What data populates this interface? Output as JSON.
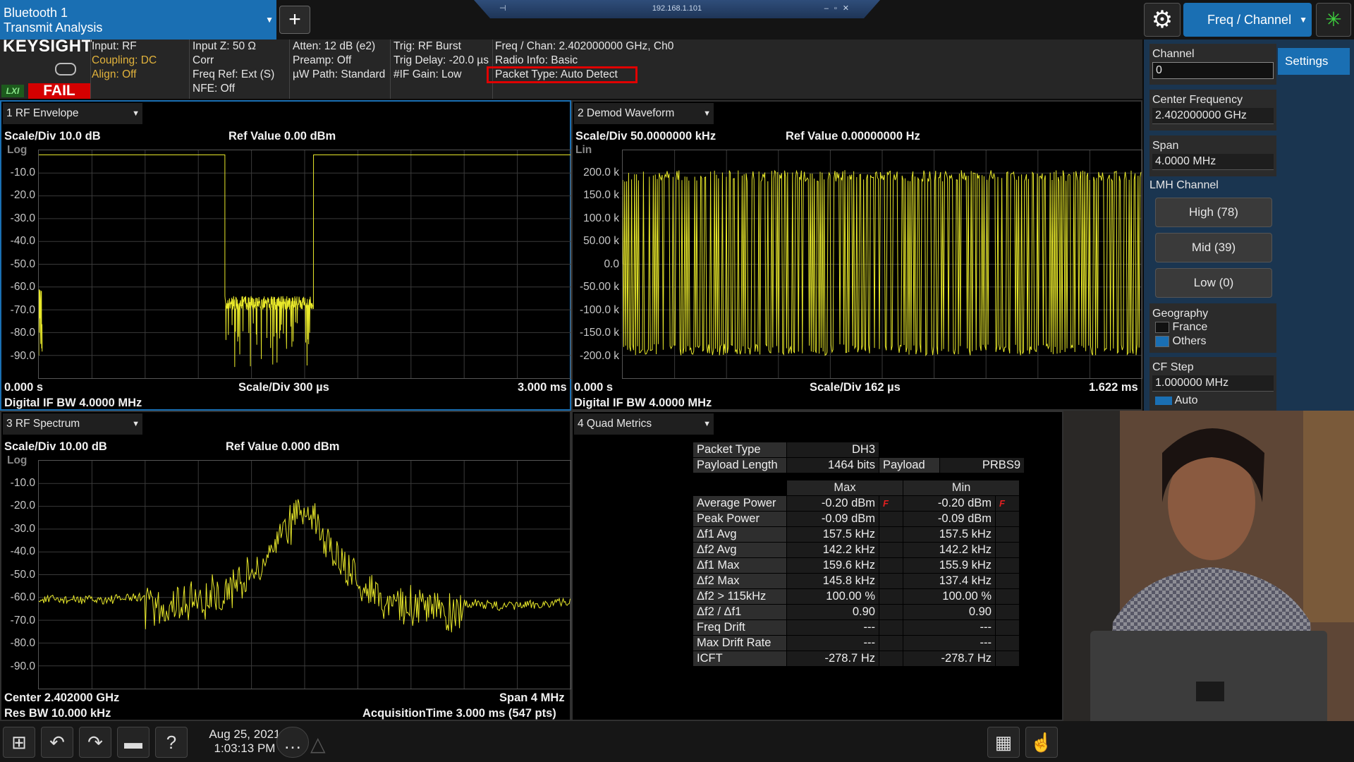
{
  "app": {
    "name_line1": "Bluetooth 1",
    "name_line2": "Transmit Analysis",
    "add_label": "+"
  },
  "remote": {
    "address": "192.168.1.101"
  },
  "menu": {
    "label": "Freq / Channel",
    "settings_tab": "Settings"
  },
  "status": {
    "brand": "KEYSIGHT",
    "lxi": "LXI",
    "fail": "FAIL",
    "col1": [
      "Input: RF",
      "Coupling: DC",
      "Align: Off"
    ],
    "col2": [
      "Input Z: 50 Ω",
      "Corr",
      "Freq Ref: Ext (S)",
      "NFE: Off"
    ],
    "col3": [
      "Atten: 12 dB (e2)",
      "Preamp: Off",
      "µW Path: Standard"
    ],
    "col4": [
      "Trig: RF Burst",
      "Trig Delay: -20.0 µs",
      "#IF Gain: Low"
    ],
    "col5": [
      "Freq / Chan: 2.402000000 GHz, Ch0",
      "Radio Info: Basic",
      "Packet Type: Auto Detect"
    ],
    "colors": {
      "warn": "#e2b33c",
      "fail": "#d40000",
      "trace": "#e8e82a",
      "accent": "#1a6fb3"
    }
  },
  "windows": [
    {
      "title": "1 RF Envelope",
      "scale": "Scale/Div 10.0 dB",
      "ref": "Ref Value 0.00 dBm",
      "mode": "Log",
      "yticks": [
        "-10.0",
        "-20.0",
        "-30.0",
        "-40.0",
        "-50.0",
        "-60.0",
        "-70.0",
        "-80.0",
        "-90.0"
      ],
      "start": "0.000 s",
      "center": "Scale/Div 300 µs",
      "stop": "3.000 ms",
      "foot": "Digital IF BW 4.0000 MHz"
    },
    {
      "title": "2 Demod Waveform",
      "scale": "Scale/Div 50.0000000 kHz",
      "ref": "Ref Value 0.00000000 Hz",
      "mode": "Lin",
      "yticks": [
        "200.0 k",
        "150.0 k",
        "100.0 k",
        "50.00 k",
        "0.0",
        "-50.00 k",
        "-100.0 k",
        "-150.0 k",
        "-200.0 k"
      ],
      "start": "0.000 s",
      "center": "Scale/Div 162 µs",
      "stop": "1.622 ms",
      "foot": "Digital IF BW 4.0000 MHz"
    },
    {
      "title": "3 RF Spectrum",
      "scale": "Scale/Div 10.00 dB",
      "ref": "Ref Value 0.000 dBm",
      "mode": "Log",
      "yticks": [
        "-10.0",
        "-20.0",
        "-30.0",
        "-40.0",
        "-50.0",
        "-60.0",
        "-70.0",
        "-80.0",
        "-90.0"
      ],
      "center_freq": "Center 2.402000 GHz",
      "span": "Span 4 MHz",
      "rbw": "Res BW 10.000 kHz",
      "acq": "AcquisitionTime 3.000 ms (547 pts)"
    },
    {
      "title": "4 Quad Metrics"
    }
  ],
  "chart_data": [
    {
      "type": "line",
      "title": "1 RF Envelope",
      "ylabel": "dBm",
      "ylim": [
        -100,
        0
      ],
      "xlim": [
        0,
        3.0
      ],
      "x_unit": "ms",
      "series": [
        {
          "values_summary": "burst at about -2 dBm from 0 to 1.05 ms, noise near -65 to -95 dBm from 1.05 to 1.55 ms, burst at about -2 dBm from 1.55 to 3.0 ms"
        }
      ],
      "x": [
        0.0,
        1.05,
        1.06,
        1.55,
        1.56,
        3.0
      ],
      "y": [
        -2,
        -2,
        -65,
        -65,
        -2,
        -2
      ]
    },
    {
      "type": "line",
      "title": "2 Demod Waveform",
      "ylabel": "Hz",
      "ylim": [
        -200000,
        200000
      ],
      "xlim": [
        0,
        1.622
      ],
      "x_unit": "ms",
      "x": [
        0,
        1.622
      ],
      "y_band": [
        -160000,
        165000
      ]
    },
    {
      "type": "line",
      "title": "3 RF Spectrum",
      "ylabel": "dBm",
      "ylim": [
        -100,
        0
      ],
      "xlim": [
        2400,
        2404
      ],
      "x_unit": "MHz",
      "x": [
        2400.0,
        2400.5,
        2401.0,
        2401.4,
        2401.7,
        2402.0,
        2402.3,
        2402.6,
        2403.0,
        2403.5,
        2404.0
      ],
      "y": [
        -60,
        -60,
        -58,
        -52,
        -40,
        -13,
        -40,
        -55,
        -60,
        -63,
        -61
      ]
    }
  ],
  "quad": {
    "packet_type_label": "Packet Type",
    "packet_type": "DH3",
    "payload_length_label": "Payload Length",
    "payload_length": "1464 bits",
    "payload_label": "Payload",
    "payload": "PRBS9",
    "col_max": "Max",
    "col_min": "Min",
    "rows": [
      {
        "name": "Average Power",
        "max": "-0.20 dBm",
        "min": "-0.20 dBm",
        "flag": "F"
      },
      {
        "name": "Peak Power",
        "max": "-0.09 dBm",
        "min": "-0.09 dBm",
        "flag": ""
      },
      {
        "name": "Δf1 Avg",
        "max": "157.5 kHz",
        "min": "157.5 kHz",
        "flag": ""
      },
      {
        "name": "Δf2 Avg",
        "max": "142.2 kHz",
        "min": "142.2 kHz",
        "flag": ""
      },
      {
        "name": "Δf1 Max",
        "max": "159.6 kHz",
        "min": "155.9 kHz",
        "flag": ""
      },
      {
        "name": "Δf2 Max",
        "max": "145.8 kHz",
        "min": "137.4 kHz",
        "flag": ""
      },
      {
        "name": "Δf2 > 115kHz",
        "max": "100.00 %",
        "min": "100.00 %",
        "flag": ""
      },
      {
        "name": "Δf2 / Δf1",
        "max": "0.90",
        "min": "0.90",
        "flag": ""
      },
      {
        "name": "Freq Drift",
        "max": "---",
        "min": "---",
        "flag": ""
      },
      {
        "name": "Max Drift Rate",
        "max": "---",
        "min": "---",
        "flag": ""
      },
      {
        "name": "ICFT",
        "max": "-278.7 Hz",
        "min": "-278.7 Hz",
        "flag": ""
      }
    ]
  },
  "side": {
    "channel_label": "Channel",
    "channel_value": "0",
    "center_label": "Center Frequency",
    "center_value": "2.402000000 GHz",
    "span_label": "Span",
    "span_value": "4.0000 MHz",
    "lmh_label": "LMH Channel",
    "high": "High (78)",
    "mid": "Mid (39)",
    "low": "Low (0)",
    "geo_label": "Geography",
    "geo_opt1": "France",
    "geo_opt2": "Others",
    "cfstep_label": "CF Step",
    "cfstep_value": "1.000000 MHz",
    "auto_label": "Auto"
  },
  "taskbar": {
    "date": "Aug 25, 2021",
    "time": "1:03:13 PM"
  }
}
